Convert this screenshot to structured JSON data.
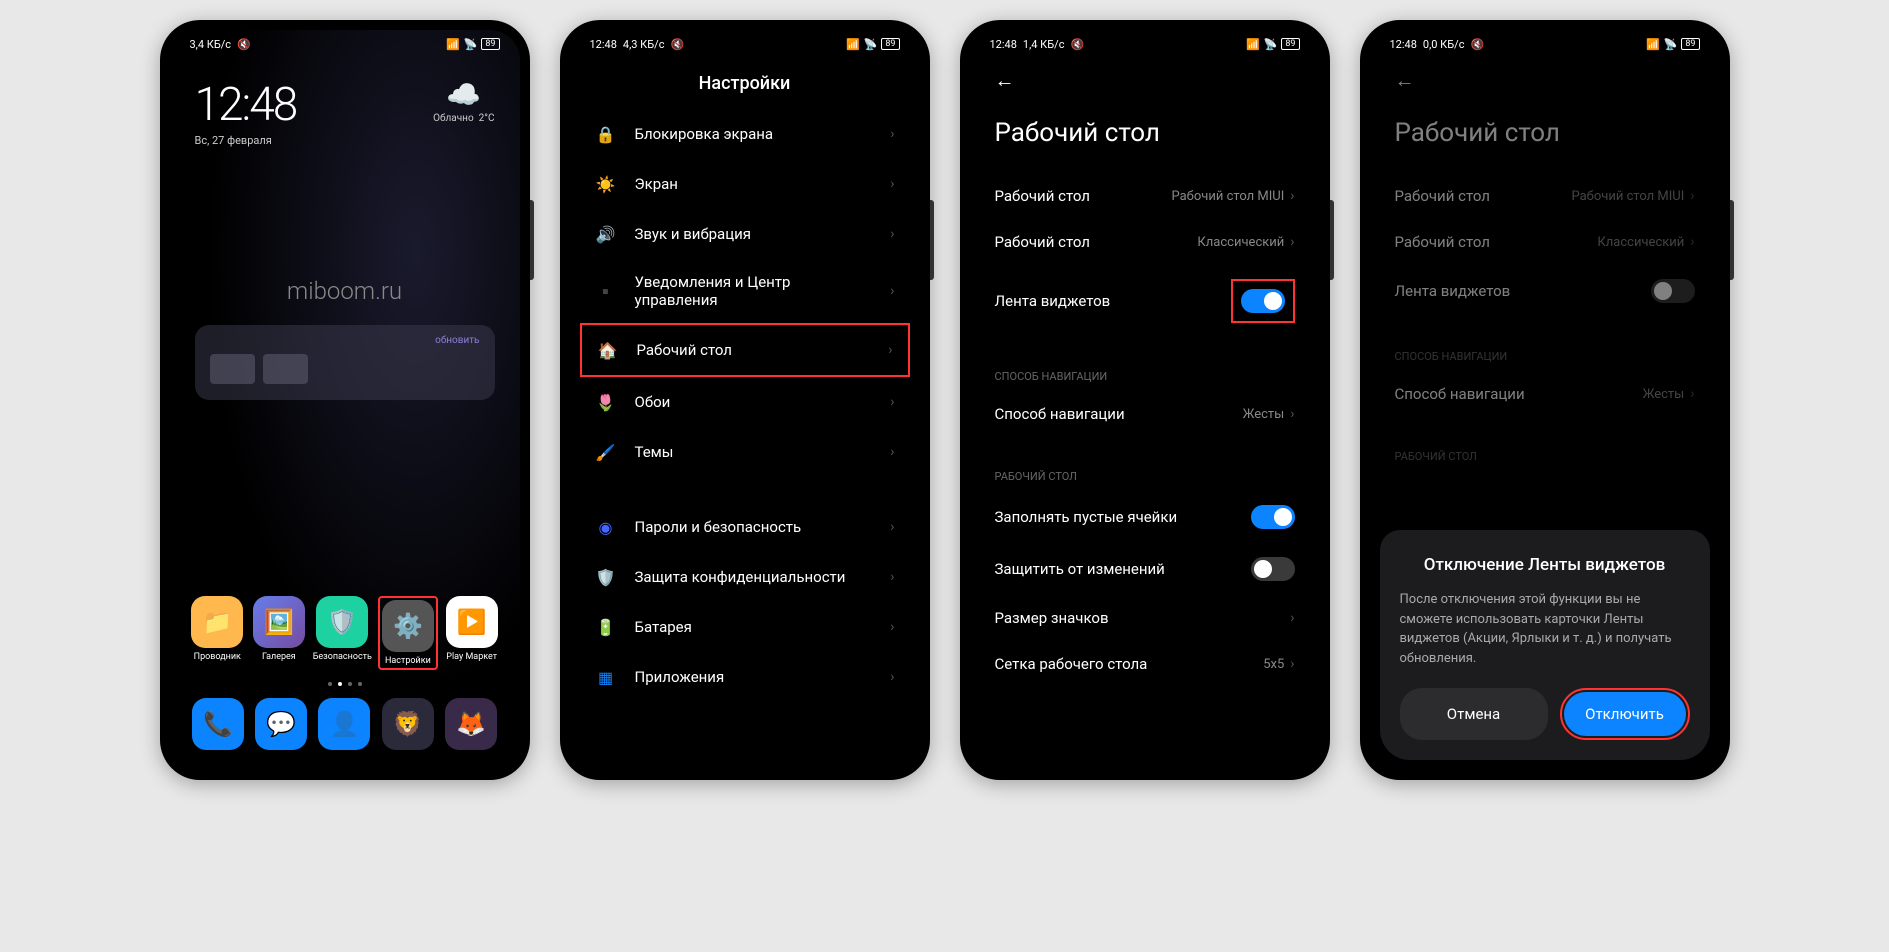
{
  "screen1": {
    "status": {
      "speed": "3,4 КБ/с",
      "battery": "89"
    },
    "clock": {
      "time": "12:48",
      "date": "Вс, 27 февраля"
    },
    "weather": {
      "condition": "Облачно",
      "temp": "2°C"
    },
    "watermark": "miboom.ru",
    "widget": {
      "update": "обновить"
    },
    "apps": [
      {
        "label": "Проводник",
        "color": "#ffb84d"
      },
      {
        "label": "Галерея",
        "color": "#4d9fff"
      },
      {
        "label": "Безопасность",
        "color": "#1dd1a1"
      },
      {
        "label": "Настройки",
        "color": "#888"
      },
      {
        "label": "Play Маркет",
        "color": "#fff"
      }
    ],
    "dock": [
      {
        "color": "#0d84ff"
      },
      {
        "color": "#0d84ff"
      },
      {
        "color": "#0d84ff"
      },
      {
        "color": "#2a2a3a"
      },
      {
        "color": "#3a2a4a"
      }
    ]
  },
  "screen2": {
    "status": {
      "time": "12:48",
      "speed": "4,3 КБ/с",
      "battery": "89"
    },
    "title": "Настройки",
    "items": [
      {
        "label": "Блокировка экрана",
        "color": "#ff4444"
      },
      {
        "label": "Экран",
        "color": "#ffaa00"
      },
      {
        "label": "Звук и вибрация",
        "color": "#1dd1a1"
      },
      {
        "label": "Уведомления и Центр управления",
        "color": "#0d84ff"
      },
      {
        "label": "Рабочий стол",
        "color": "#a259ff",
        "highlight": true
      },
      {
        "label": "Обои",
        "color": "#ff4466"
      },
      {
        "label": "Темы",
        "color": "#0d84ff"
      }
    ],
    "items2": [
      {
        "label": "Пароли и безопасность",
        "color": "#4466ff"
      },
      {
        "label": "Защита конфиденциальности",
        "color": "#0d84ff"
      },
      {
        "label": "Батарея",
        "color": "#1dd1a1"
      },
      {
        "label": "Приложения",
        "color": "#0d84ff"
      }
    ]
  },
  "screen3": {
    "status": {
      "time": "12:48",
      "speed": "1,4 КБ/с",
      "battery": "89"
    },
    "title": "Рабочий стол",
    "item1": {
      "label": "Рабочий стол",
      "value": "Рабочий стол MIUI"
    },
    "item2": {
      "label": "Рабочий стол",
      "value": "Классический"
    },
    "item3": {
      "label": "Лента виджетов"
    },
    "section1": "СПОСОБ НАВИГАЦИИ",
    "nav": {
      "label": "Способ навигации",
      "value": "Жесты"
    },
    "section2": "РАБОЧИЙ СТОЛ",
    "fill": {
      "label": "Заполнять пустые ячейки"
    },
    "protect": {
      "label": "Защитить от изменений"
    },
    "iconsize": {
      "label": "Размер значков"
    },
    "grid": {
      "label": "Сетка рабочего стола",
      "value": "5x5"
    }
  },
  "screen4": {
    "status": {
      "time": "12:48",
      "speed": "0,0 КБ/с",
      "battery": "89"
    },
    "title": "Рабочий стол",
    "item1": {
      "label": "Рабочий стол",
      "value": "Рабочий стол MIUI"
    },
    "item2": {
      "label": "Рабочий стол",
      "value": "Классический"
    },
    "item3": {
      "label": "Лента виджетов"
    },
    "section1": "СПОСОБ НАВИГАЦИИ",
    "nav": {
      "label": "Способ навигации",
      "value": "Жесты"
    },
    "section2": "РАБОЧИЙ СТОЛ",
    "dialog": {
      "title": "Отключение Ленты виджетов",
      "text": "После отключения этой функции вы не сможете использовать карточки Ленты виджетов (Акции, Ярлыки и т. д.) и получать обновления.",
      "cancel": "Отмена",
      "confirm": "Отключить"
    }
  }
}
